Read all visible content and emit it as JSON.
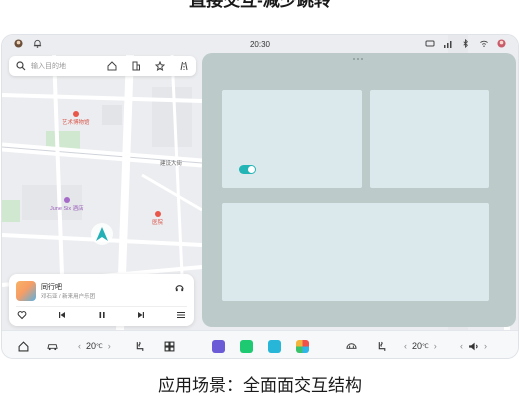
{
  "heading": "直接交互-减少跳转",
  "caption": "应用场景：全面面交互结构",
  "status_bar": {
    "time": "20:30",
    "left_icons": [
      "avatar-icon",
      "bell-icon"
    ],
    "right_icons": [
      "car-status-icon",
      "signal-icon",
      "bluetooth-icon",
      "wifi-icon",
      "user-icon"
    ]
  },
  "search": {
    "placeholder": "输入目的地",
    "tools": [
      "home-icon",
      "company-icon",
      "favorite-icon",
      "route-icon"
    ]
  },
  "map": {
    "pois": [
      {
        "label": "艺术博物馆",
        "type": "red"
      },
      {
        "label": "June Six 酒店",
        "type": "purple"
      },
      {
        "label": "医院",
        "type": "red"
      }
    ],
    "road_label": "建设大街"
  },
  "music": {
    "title": "同行吧",
    "artist": "邓石亚 / 新来用户乐团",
    "controls": [
      "heart-icon",
      "previous-icon",
      "pause-icon",
      "next-icon",
      "playlist-icon"
    ]
  },
  "dock": {
    "left_temp": "20",
    "left_temp_unit": "℃",
    "right_temp": "20",
    "right_temp_unit": "℃",
    "apps": [
      {
        "name": "voice-app-icon",
        "color": "#6b5bd6"
      },
      {
        "name": "iqiyi-app-icon",
        "color": "#1dc971"
      },
      {
        "name": "store-app-icon",
        "color": "#27b6d8"
      },
      {
        "name": "apps-grid-icon",
        "color": "#f2b43a"
      }
    ]
  },
  "colors": {
    "panel": "#bccaca",
    "card": "#dbe8ec",
    "toggle": "#23b5b5",
    "map_bg": "#ecedf0"
  }
}
